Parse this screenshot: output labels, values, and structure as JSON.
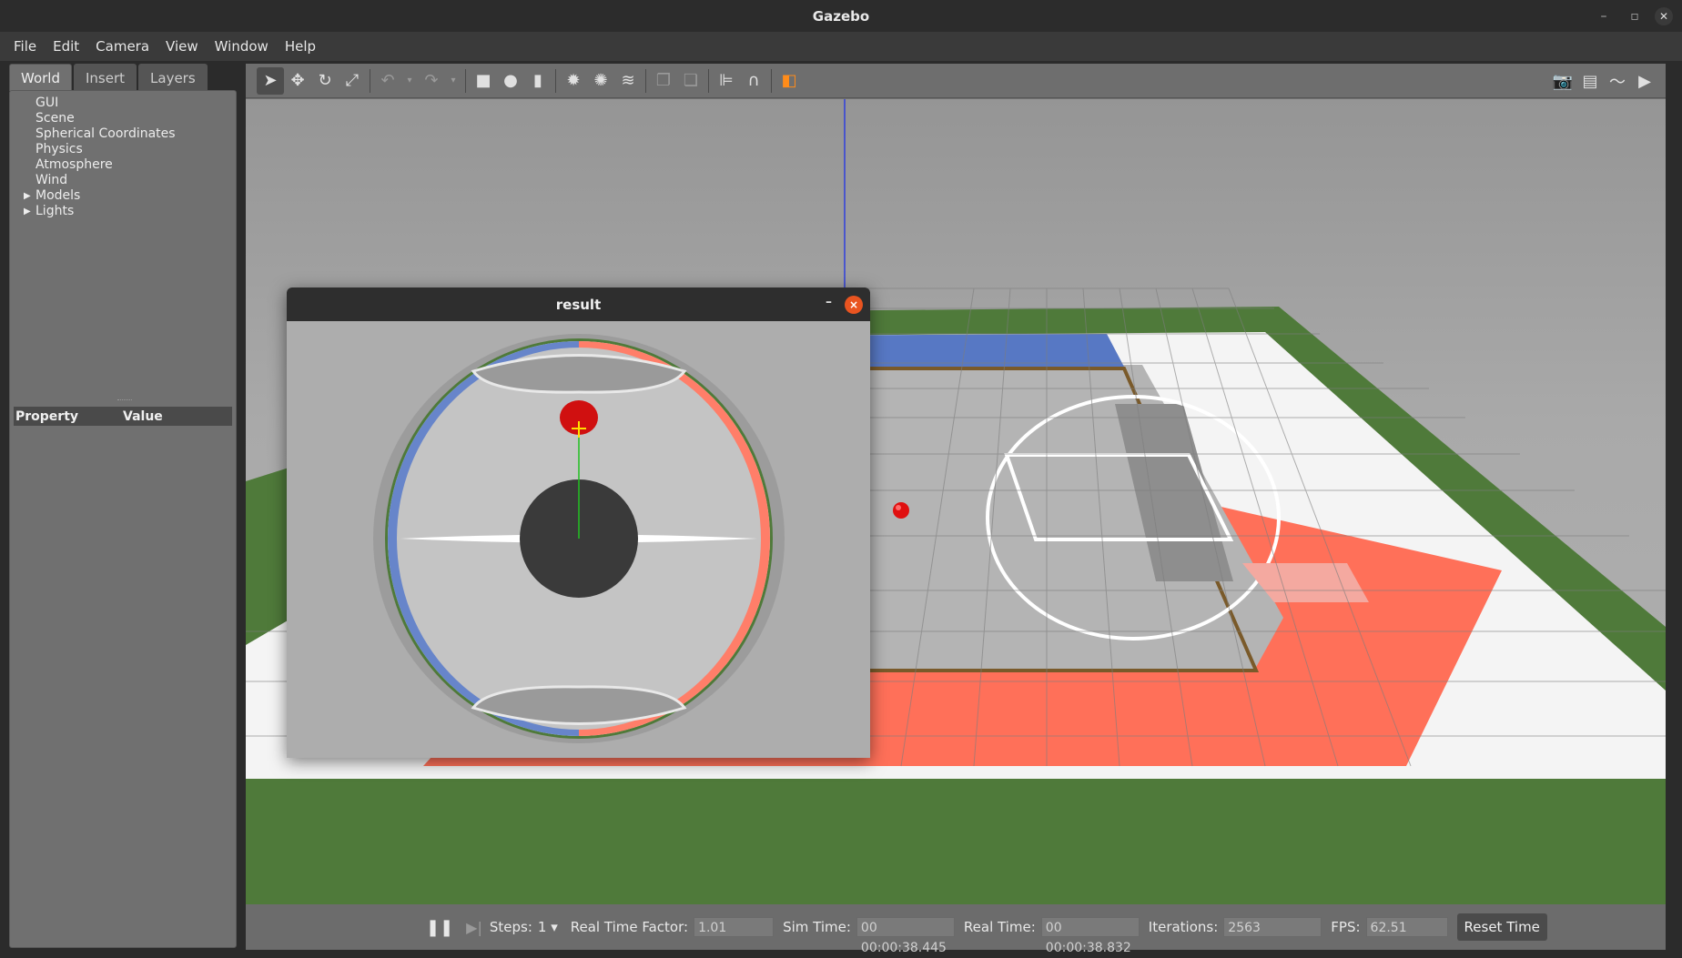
{
  "window": {
    "title": "Gazebo"
  },
  "menu": [
    "File",
    "Edit",
    "Camera",
    "View",
    "Window",
    "Help"
  ],
  "left_tabs": [
    "World",
    "Insert",
    "Layers"
  ],
  "tree": [
    {
      "label": "GUI",
      "expandable": false
    },
    {
      "label": "Scene",
      "expandable": false
    },
    {
      "label": "Spherical Coordinates",
      "expandable": false
    },
    {
      "label": "Physics",
      "expandable": false
    },
    {
      "label": "Atmosphere",
      "expandable": false
    },
    {
      "label": "Wind",
      "expandable": false
    },
    {
      "label": "Models",
      "expandable": true
    },
    {
      "label": "Lights",
      "expandable": true
    }
  ],
  "property_table": {
    "col1": "Property",
    "col2": "Value"
  },
  "bottom": {
    "steps_label": "Steps:",
    "steps_value": "1",
    "rtf_label": "Real Time Factor:",
    "rtf_value": "1.01",
    "sim_label": "Sim Time:",
    "sim_value": "00 00:00:38.445",
    "real_label": "Real Time:",
    "real_value": "00 00:00:38.832",
    "iter_label": "Iterations:",
    "iter_value": "2563",
    "fps_label": "FPS:",
    "fps_value": "62.51",
    "reset_label": "Reset Time"
  },
  "result_window": {
    "title": "result",
    "minimize": "–",
    "close": "×"
  },
  "colors": {
    "field_green": "#4f7a3a",
    "court_gray": "#b4b4b4",
    "orange": "#ff7059",
    "blue": "#5778c4",
    "ball_red": "#e01010"
  }
}
